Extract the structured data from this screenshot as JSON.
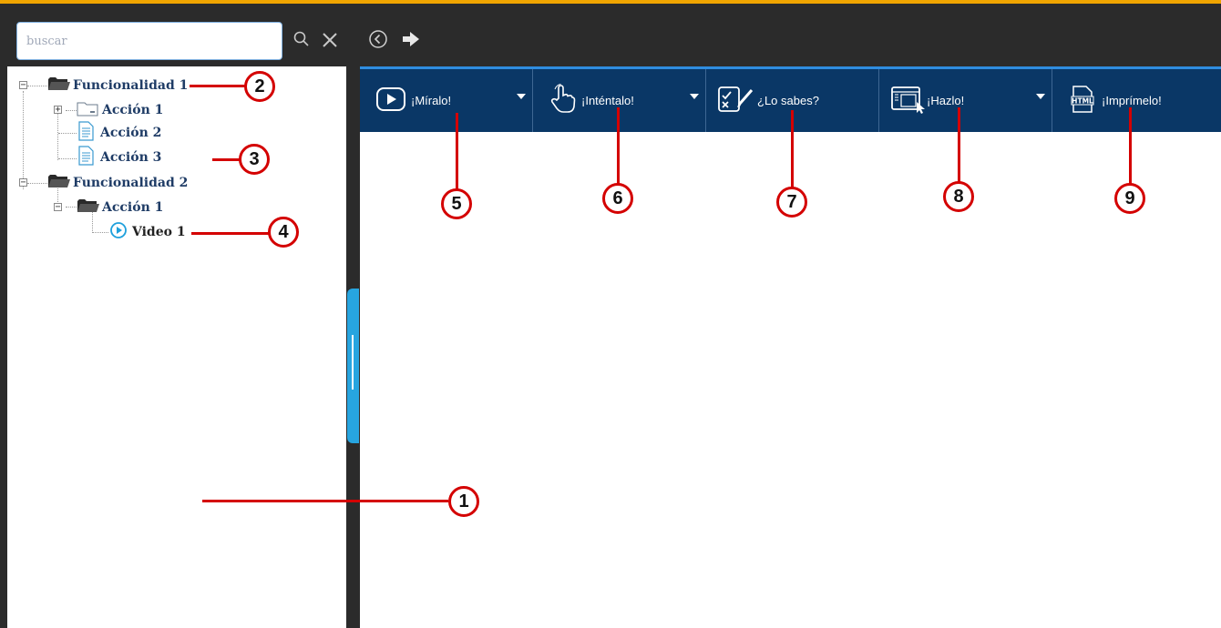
{
  "search": {
    "placeholder": "buscar"
  },
  "nav_icons": [
    "search-icon",
    "clear-icon",
    "back-icon",
    "forward-icon"
  ],
  "tree": {
    "items": [
      {
        "label": "Funcionalidad 1",
        "icon": "folder-open-icon",
        "expander": "−"
      },
      {
        "label": "Acción 1",
        "icon": "folder-icon",
        "expander": "+"
      },
      {
        "label": "Acción 2",
        "icon": "document-icon"
      },
      {
        "label": "Acción 3",
        "icon": "document-icon"
      },
      {
        "label": "Funcionalidad 2",
        "icon": "folder-open-icon",
        "expander": "−"
      },
      {
        "label": "Acción 1",
        "icon": "folder-open-icon",
        "expander": "−"
      },
      {
        "label": "Video 1",
        "icon": "play-icon"
      }
    ]
  },
  "toolbar": {
    "buttons": [
      {
        "label": "¡Míralo!",
        "icon": "play-icon"
      },
      {
        "label": "¡Inténtalo!",
        "icon": "hand-pointer-icon"
      },
      {
        "label": "¿Lo sabes?",
        "icon": "quiz-icon"
      },
      {
        "label": "¡Hazlo!",
        "icon": "window-cursor-icon"
      },
      {
        "label": "¡Imprímelo!",
        "icon": "html-document-icon"
      }
    ]
  },
  "callouts": [
    "1",
    "2",
    "3",
    "4",
    "5",
    "6",
    "7",
    "8",
    "9"
  ],
  "colors": {
    "accent_orange": "#f0a500",
    "toolbar_bg": "#0a3766",
    "toolbar_border": "#2f8de0",
    "tree_text": "#1f3c66",
    "callout_red": "#d40000",
    "splitter_handle": "#27a5e0"
  }
}
